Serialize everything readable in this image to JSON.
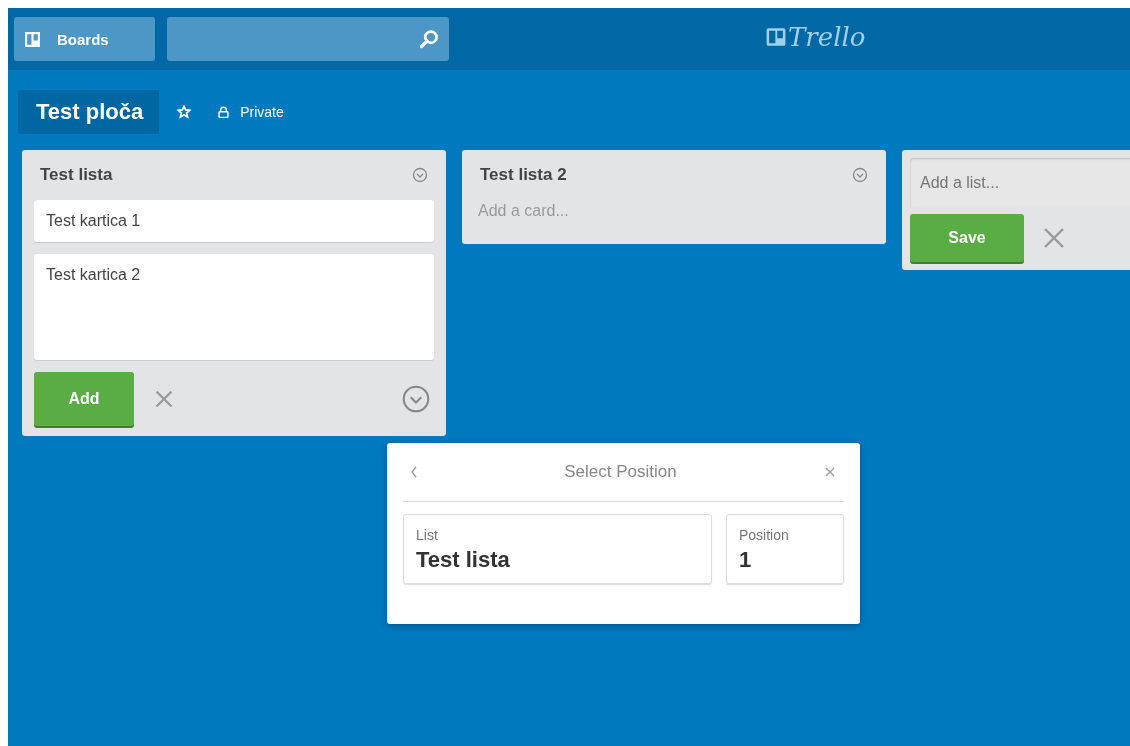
{
  "header": {
    "boards_button": "Boards",
    "logo": "Trello"
  },
  "board": {
    "title": "Test ploča",
    "visibility": "Private"
  },
  "lists": [
    {
      "title": "Test lista",
      "cards": [
        "Test kartica 1"
      ],
      "composer": {
        "value": "Test kartica 2",
        "button": "Add"
      }
    },
    {
      "title": "Test lista 2",
      "add_card": "Add a card..."
    }
  ],
  "add_list": {
    "placeholder": "Add a list...",
    "button": "Save"
  },
  "popover": {
    "title": "Select Position",
    "fields": [
      {
        "label": "List",
        "value": "Test lista"
      },
      {
        "label": "Position",
        "value": "1"
      }
    ]
  }
}
